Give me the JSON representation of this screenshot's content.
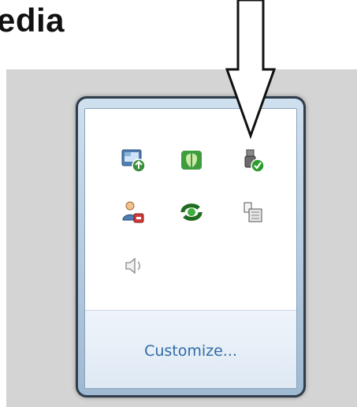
{
  "heading": "edia",
  "tray": {
    "icons": [
      "windows-update-icon",
      "security-shield-icon",
      "usb-safely-remove-icon",
      "user-account-alert-icon",
      "sync-icon",
      "network-adapter-icon",
      "volume-speaker-icon"
    ],
    "customize_label": "Customize..."
  },
  "colors": {
    "accent": "#2f6aa8",
    "popup_frame": "#2f3c4a",
    "check_green": "#2e9b2e",
    "alert_red": "#d33b3b"
  }
}
